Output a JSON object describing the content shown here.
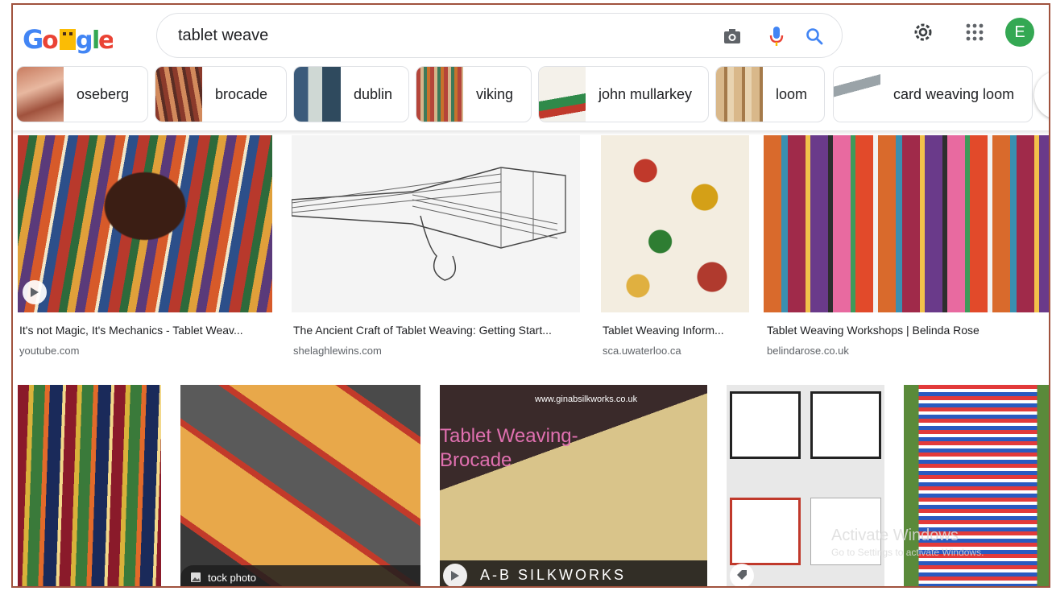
{
  "search": {
    "query": "tablet weave"
  },
  "header": {
    "avatar_letter": "E",
    "logo_alt": "Google"
  },
  "chips": [
    {
      "label": "oseberg"
    },
    {
      "label": "brocade"
    },
    {
      "label": "dublin"
    },
    {
      "label": "viking"
    },
    {
      "label": "john mullarkey"
    },
    {
      "label": "loom"
    },
    {
      "label": "card weaving loom"
    }
  ],
  "results_row1": [
    {
      "title": "It's not Magic, It's Mechanics - Tablet Weav...",
      "source": "youtube.com"
    },
    {
      "title": "The Ancient Craft of Tablet Weaving: Getting Start...",
      "source": "shelaghlewins.com"
    },
    {
      "title": "Tablet Weaving Inform...",
      "source": "sca.uwaterloo.ca"
    },
    {
      "title": "Tablet Weaving Workshops | Belinda Rose",
      "source": "belindarose.co.uk"
    }
  ],
  "results_row2": {
    "stock_label": "tock photo",
    "gina_url": "www.ginabsilkworks.co.uk",
    "gina_title_1": "Tablet Weaving-",
    "gina_title_2": "Brocade",
    "gina_brand": "A-B SILKWORKS"
  },
  "watermark": {
    "line1": "Activate Windows",
    "line2": "Go to Settings to activate Windows."
  },
  "colors": {
    "frame": "#a0523d",
    "avatar": "#34a853",
    "google_blue": "#4285f4"
  }
}
